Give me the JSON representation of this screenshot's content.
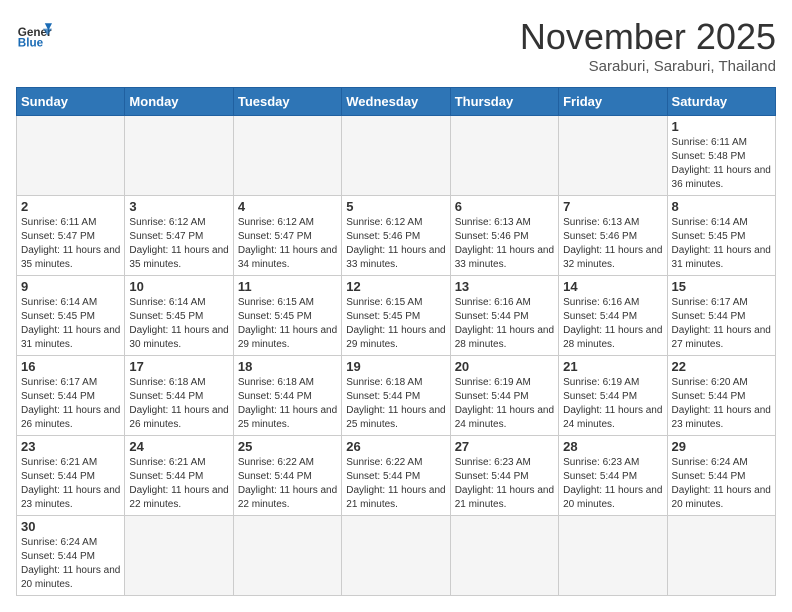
{
  "logo": {
    "line1": "General",
    "line2": "Blue"
  },
  "title": "November 2025",
  "subtitle": "Saraburi, Saraburi, Thailand",
  "weekdays": [
    "Sunday",
    "Monday",
    "Tuesday",
    "Wednesday",
    "Thursday",
    "Friday",
    "Saturday"
  ],
  "days": {
    "d1": {
      "num": "1",
      "rise": "6:11 AM",
      "set": "5:48 PM",
      "hours": "11 hours and 36 minutes."
    },
    "d2": {
      "num": "2",
      "rise": "6:11 AM",
      "set": "5:47 PM",
      "hours": "11 hours and 35 minutes."
    },
    "d3": {
      "num": "3",
      "rise": "6:12 AM",
      "set": "5:47 PM",
      "hours": "11 hours and 35 minutes."
    },
    "d4": {
      "num": "4",
      "rise": "6:12 AM",
      "set": "5:47 PM",
      "hours": "11 hours and 34 minutes."
    },
    "d5": {
      "num": "5",
      "rise": "6:12 AM",
      "set": "5:46 PM",
      "hours": "11 hours and 33 minutes."
    },
    "d6": {
      "num": "6",
      "rise": "6:13 AM",
      "set": "5:46 PM",
      "hours": "11 hours and 33 minutes."
    },
    "d7": {
      "num": "7",
      "rise": "6:13 AM",
      "set": "5:46 PM",
      "hours": "11 hours and 32 minutes."
    },
    "d8": {
      "num": "8",
      "rise": "6:14 AM",
      "set": "5:45 PM",
      "hours": "11 hours and 31 minutes."
    },
    "d9": {
      "num": "9",
      "rise": "6:14 AM",
      "set": "5:45 PM",
      "hours": "11 hours and 31 minutes."
    },
    "d10": {
      "num": "10",
      "rise": "6:14 AM",
      "set": "5:45 PM",
      "hours": "11 hours and 30 minutes."
    },
    "d11": {
      "num": "11",
      "rise": "6:15 AM",
      "set": "5:45 PM",
      "hours": "11 hours and 29 minutes."
    },
    "d12": {
      "num": "12",
      "rise": "6:15 AM",
      "set": "5:45 PM",
      "hours": "11 hours and 29 minutes."
    },
    "d13": {
      "num": "13",
      "rise": "6:16 AM",
      "set": "5:44 PM",
      "hours": "11 hours and 28 minutes."
    },
    "d14": {
      "num": "14",
      "rise": "6:16 AM",
      "set": "5:44 PM",
      "hours": "11 hours and 28 minutes."
    },
    "d15": {
      "num": "15",
      "rise": "6:17 AM",
      "set": "5:44 PM",
      "hours": "11 hours and 27 minutes."
    },
    "d16": {
      "num": "16",
      "rise": "6:17 AM",
      "set": "5:44 PM",
      "hours": "11 hours and 26 minutes."
    },
    "d17": {
      "num": "17",
      "rise": "6:18 AM",
      "set": "5:44 PM",
      "hours": "11 hours and 26 minutes."
    },
    "d18": {
      "num": "18",
      "rise": "6:18 AM",
      "set": "5:44 PM",
      "hours": "11 hours and 25 minutes."
    },
    "d19": {
      "num": "19",
      "rise": "6:18 AM",
      "set": "5:44 PM",
      "hours": "11 hours and 25 minutes."
    },
    "d20": {
      "num": "20",
      "rise": "6:19 AM",
      "set": "5:44 PM",
      "hours": "11 hours and 24 minutes."
    },
    "d21": {
      "num": "21",
      "rise": "6:19 AM",
      "set": "5:44 PM",
      "hours": "11 hours and 24 minutes."
    },
    "d22": {
      "num": "22",
      "rise": "6:20 AM",
      "set": "5:44 PM",
      "hours": "11 hours and 23 minutes."
    },
    "d23": {
      "num": "23",
      "rise": "6:21 AM",
      "set": "5:44 PM",
      "hours": "11 hours and 23 minutes."
    },
    "d24": {
      "num": "24",
      "rise": "6:21 AM",
      "set": "5:44 PM",
      "hours": "11 hours and 22 minutes."
    },
    "d25": {
      "num": "25",
      "rise": "6:22 AM",
      "set": "5:44 PM",
      "hours": "11 hours and 22 minutes."
    },
    "d26": {
      "num": "26",
      "rise": "6:22 AM",
      "set": "5:44 PM",
      "hours": "11 hours and 21 minutes."
    },
    "d27": {
      "num": "27",
      "rise": "6:23 AM",
      "set": "5:44 PM",
      "hours": "11 hours and 21 minutes."
    },
    "d28": {
      "num": "28",
      "rise": "6:23 AM",
      "set": "5:44 PM",
      "hours": "11 hours and 20 minutes."
    },
    "d29": {
      "num": "29",
      "rise": "6:24 AM",
      "set": "5:44 PM",
      "hours": "11 hours and 20 minutes."
    },
    "d30": {
      "num": "30",
      "rise": "6:24 AM",
      "set": "5:44 PM",
      "hours": "11 hours and 20 minutes."
    }
  },
  "labels": {
    "sunrise": "Sunrise:",
    "sunset": "Sunset:",
    "daylight": "Daylight:"
  }
}
